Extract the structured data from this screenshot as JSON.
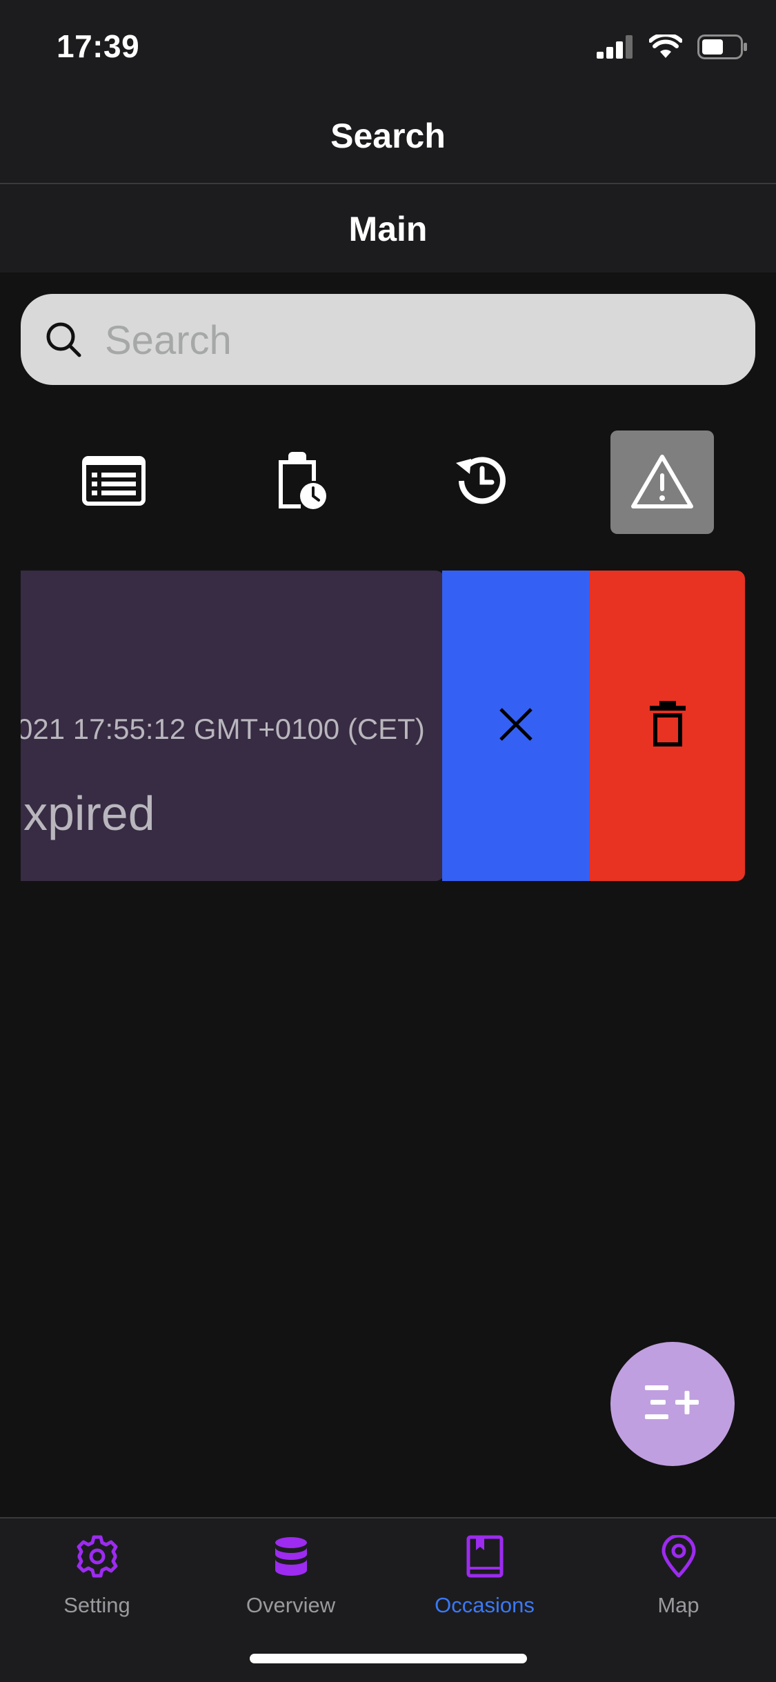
{
  "status_bar": {
    "time": "17:39",
    "icons": [
      "signal-icon",
      "wifi-icon",
      "battery-icon"
    ]
  },
  "header": {
    "title": "Search"
  },
  "subheader": {
    "title": "Main"
  },
  "search": {
    "placeholder": "Search",
    "value": ""
  },
  "filters": [
    {
      "icon": "list-icon",
      "active": false
    },
    {
      "icon": "clipboard-clock-icon",
      "active": false
    },
    {
      "icon": "history-icon",
      "active": false
    },
    {
      "icon": "warning-icon",
      "active": true
    }
  ],
  "card": {
    "date_text": "021 17:55:12 GMT+0100 (CET)",
    "status_text": "xpired",
    "actions": [
      {
        "icon": "close-icon",
        "color": "#3560f4"
      },
      {
        "icon": "trash-icon",
        "color": "#e83222"
      }
    ]
  },
  "fab": {
    "icon": "add-list-icon",
    "color": "#c09fe0"
  },
  "bottom_nav": {
    "active": "Occasions",
    "items": [
      {
        "label": "Setting",
        "icon": "gear-icon"
      },
      {
        "label": "Overview",
        "icon": "database-icon"
      },
      {
        "label": "Occasions",
        "icon": "book-icon"
      },
      {
        "label": "Map",
        "icon": "map-pin-icon"
      }
    ]
  },
  "colors": {
    "accent": "#9d2bf0",
    "active_label": "#3a79f7",
    "card": "#372c43"
  }
}
